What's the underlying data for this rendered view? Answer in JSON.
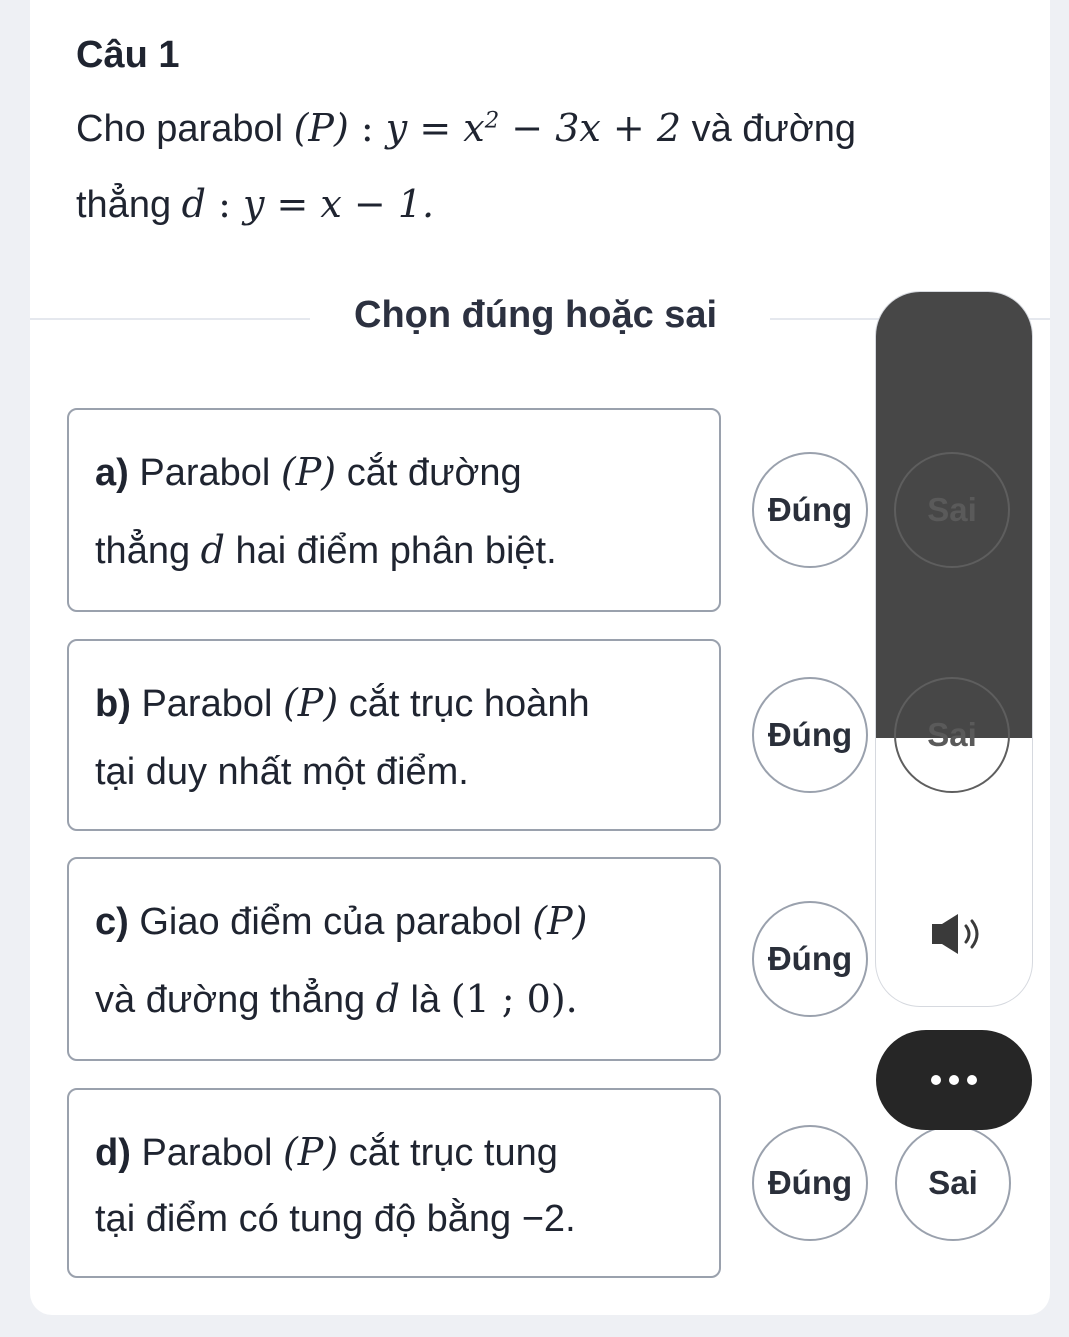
{
  "question": {
    "title": "Câu 1",
    "line1": {
      "text": "Cho parabol",
      "p": "(P)",
      "colon": " : ",
      "eq": "y = x",
      "exp": "2",
      "eq_rest": " − 3x + 2",
      "tail": "và đường"
    },
    "line2": {
      "text": "thẳng",
      "d": "d",
      "colon": " : ",
      "eq": "y = x − 1."
    }
  },
  "prompt": "Chọn đúng hoặc sai",
  "statements": [
    {
      "label": "a)",
      "pre": "Parabol",
      "p": "(P)",
      "post": "cắt đường",
      "line2a": "thẳng ",
      "line2d": "d",
      "line2b": " hai điểm phân biệt.",
      "true_label": "Đúng",
      "false_label": "Sai"
    },
    {
      "label": "b)",
      "pre": "Parabol",
      "p": "(P)",
      "post": "cắt trục hoành",
      "line2": "tại duy nhất một điểm.",
      "true_label": "Đúng",
      "false_label": "Sai"
    },
    {
      "label": "c)",
      "pre": "Giao điểm của parabol",
      "p": "(P)",
      "line2a": "và đường thẳng ",
      "line2d": "d",
      "line2b": " là",
      "pt": "(1 ; 0)",
      "pt_end": ".",
      "true_label": "Đúng"
    },
    {
      "label": "d)",
      "pre": "Parabol",
      "p": "(P)",
      "post": "cắt trục tung",
      "line2": "tại điểm có tung độ bằng −2.",
      "true_label": "Đúng",
      "false_label": "Sai"
    }
  ],
  "colors": {
    "overlay_dark": "#474747",
    "more_button": "#262626",
    "border": "#9aa1ad"
  },
  "icons": [
    "speaker-icon",
    "more-options-icon"
  ]
}
